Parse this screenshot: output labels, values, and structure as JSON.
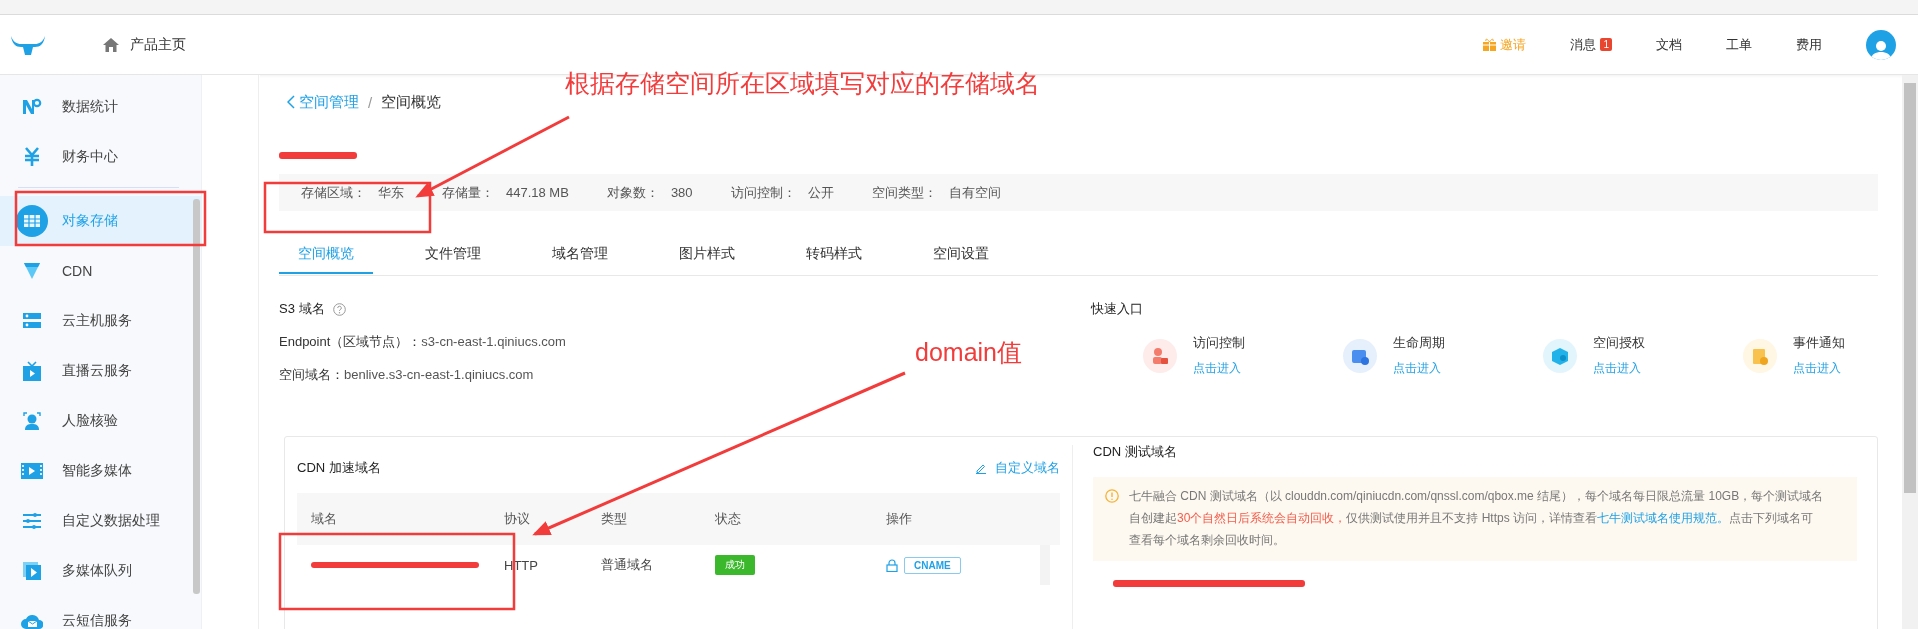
{
  "header": {
    "home_link": "产品主页",
    "actions": [
      {
        "kind": "invite",
        "label": "邀请"
      },
      {
        "kind": "messages",
        "label": "消息",
        "badge": "1"
      },
      {
        "kind": "plain",
        "label": "文档"
      },
      {
        "kind": "plain",
        "label": "工单"
      },
      {
        "kind": "plain",
        "label": "费用"
      }
    ]
  },
  "sidebar": {
    "items": [
      {
        "kind": "stats",
        "label": "数据统计",
        "selected": false
      },
      {
        "kind": "finance",
        "label": "财务中心",
        "selected": false
      },
      {
        "kind": "storage",
        "label": "对象存储",
        "selected": true
      },
      {
        "kind": "cdn",
        "label": "CDN",
        "selected": false
      },
      {
        "kind": "host",
        "label": "云主机服务",
        "selected": false
      },
      {
        "kind": "live",
        "label": "直播云服务",
        "selected": false
      },
      {
        "kind": "face",
        "label": "人脸核验",
        "selected": false
      },
      {
        "kind": "media",
        "label": "智能多媒体",
        "selected": false
      },
      {
        "kind": "sliders",
        "label": "自定义数据处理",
        "selected": false
      },
      {
        "kind": "queue",
        "label": "多媒体队列",
        "selected": false
      },
      {
        "kind": "sms",
        "label": "云短信服务",
        "selected": false
      }
    ]
  },
  "breadcrumb": {
    "parent": "空间管理",
    "separator": "/",
    "current": "空间概览"
  },
  "bucket_info": [
    {
      "label": "存储区域：",
      "value": "华东"
    },
    {
      "label": "存储量：",
      "value": "447.18 MB"
    },
    {
      "label": "对象数：",
      "value": "380"
    },
    {
      "label": "访问控制：",
      "value": "公开"
    },
    {
      "label": "空间类型：",
      "value": "自有空间"
    }
  ],
  "tabs": [
    {
      "label": "空间概览",
      "selected": true
    },
    {
      "label": "文件管理",
      "selected": false
    },
    {
      "label": "域名管理",
      "selected": false
    },
    {
      "label": "图片样式",
      "selected": false
    },
    {
      "label": "转码样式",
      "selected": false
    },
    {
      "label": "空间设置",
      "selected": false
    }
  ],
  "s3": {
    "title": "S3 域名",
    "rows": [
      {
        "label": "Endpoint（区域节点）：",
        "value": "s3-cn-east-1.qiniucs.com"
      },
      {
        "label": "空间域名：",
        "value": "benlive.s3-cn-east-1.qiniucs.com"
      }
    ]
  },
  "quick_entry": {
    "title": "快速入口",
    "items": [
      {
        "kind": "access",
        "title": "访问控制",
        "link": "点击进入"
      },
      {
        "kind": "lifecycle",
        "title": "生命周期",
        "link": "点击进入"
      },
      {
        "kind": "auth",
        "title": "空间授权",
        "link": "点击进入"
      },
      {
        "kind": "event",
        "title": "事件通知",
        "link": "点击进入"
      }
    ]
  },
  "cdn_domains": {
    "title": "CDN 加速域名",
    "action": "自定义域名",
    "columns": [
      "域名",
      "协议",
      "类型",
      "状态",
      "操作"
    ],
    "rows": [
      {
        "protocol": "HTTP",
        "type": "普通域名",
        "status": "成功",
        "operation": "CNAME"
      }
    ]
  },
  "cdn_test": {
    "title": "CDN 测试域名",
    "notice": [
      {
        "kind": "text",
        "text": "七牛融合 CDN 测试域名（以 clouddn.com/qiniucdn.com/qnssl.com/qbox.me 结尾），每个域名每日限总流量 10GB，每个测试域名自创建起"
      },
      {
        "kind": "warn",
        "text": "30个自然日后系统会自动回收，"
      },
      {
        "kind": "text",
        "text": "仅供测试使用并且不支持 Https 访问，详情查看"
      },
      {
        "kind": "link",
        "text": "七牛测试域名使用规范。"
      },
      {
        "kind": "text",
        "text": "点击下列域名可查看每个域名剩余回收时间。"
      }
    ]
  },
  "annotations": [
    {
      "text": "根据存储空间所在区域填写对应的存储域名"
    },
    {
      "text": "domain值"
    }
  ]
}
